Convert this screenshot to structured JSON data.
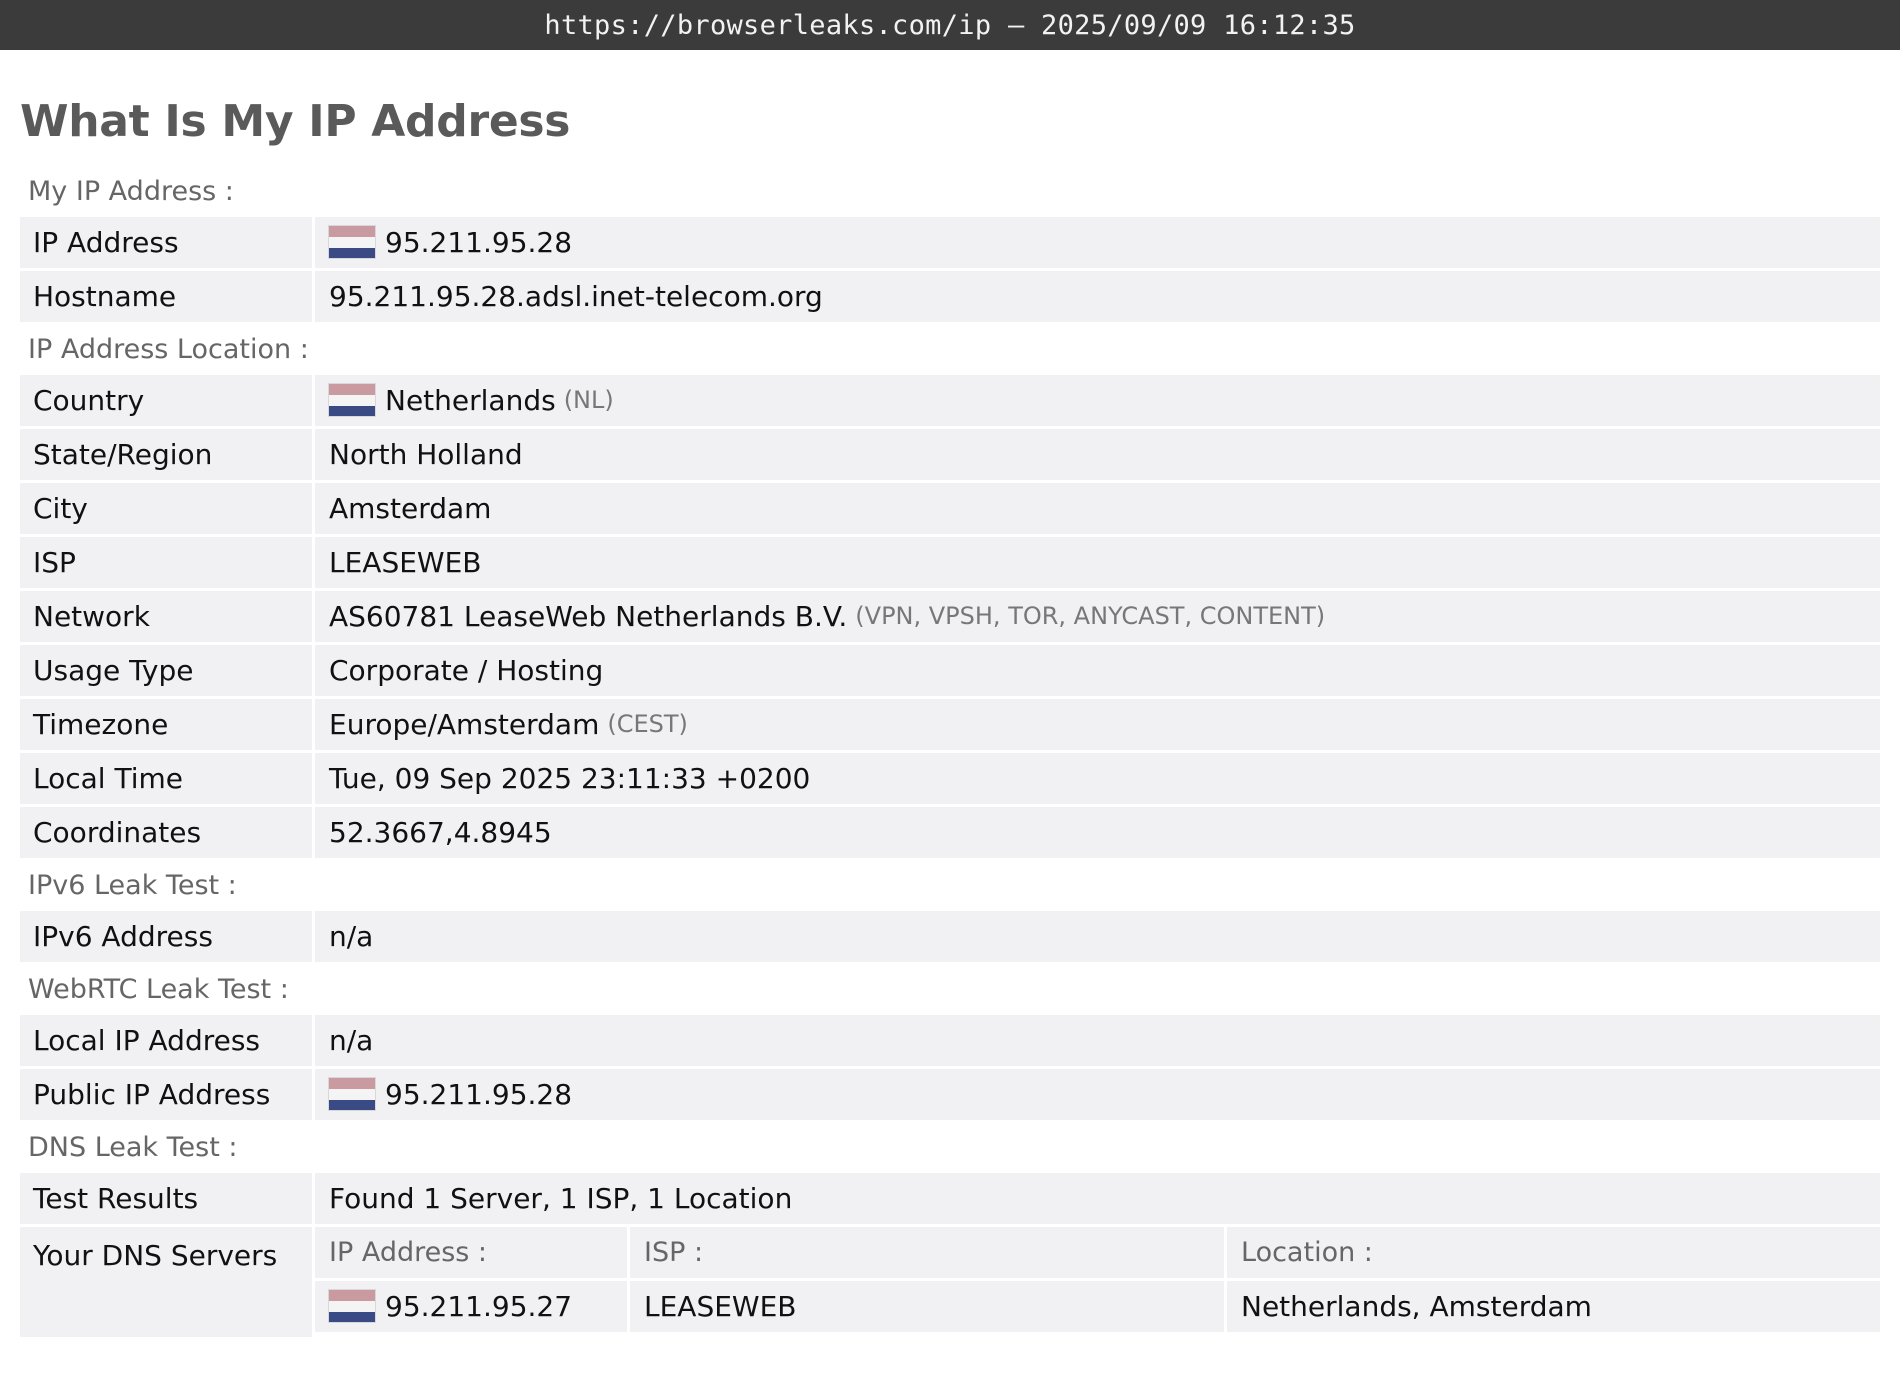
{
  "topbar": {
    "url_time": "https://browserleaks.com/ip – 2025/09/09 16:12:35"
  },
  "page_title": "What Is My IP Address",
  "sections": {
    "my_ip": {
      "title": "My IP Address :",
      "ip_label": "IP Address",
      "ip_value": "95.211.95.28",
      "hostname_label": "Hostname",
      "hostname_value": "95.211.95.28.adsl.inet-telecom.org"
    },
    "location": {
      "title": "IP Address Location :",
      "country_label": "Country",
      "country_value": "Netherlands",
      "country_code": "(NL)",
      "state_label": "State/Region",
      "state_value": "North Holland",
      "city_label": "City",
      "city_value": "Amsterdam",
      "isp_label": "ISP",
      "isp_value": "LEASEWEB",
      "network_label": "Network",
      "network_value": "AS60781 LeaseWeb Netherlands B.V.",
      "network_tags": "(VPN, VPSH, TOR, ANYCAST, CONTENT)",
      "usage_label": "Usage Type",
      "usage_value": "Corporate / Hosting",
      "timezone_label": "Timezone",
      "timezone_value": "Europe/Amsterdam",
      "timezone_abbr": "(CEST)",
      "localtime_label": "Local Time",
      "localtime_value": "Tue, 09 Sep 2025 23:11:33 +0200",
      "coords_label": "Coordinates",
      "coords_value": "52.3667,4.8945"
    },
    "ipv6": {
      "title": "IPv6 Leak Test :",
      "addr_label": "IPv6 Address",
      "addr_value": "n/a"
    },
    "webrtc": {
      "title": "WebRTC Leak Test :",
      "local_label": "Local IP Address",
      "local_value": "n/a",
      "public_label": "Public IP Address",
      "public_value": "95.211.95.28"
    },
    "dns": {
      "title": "DNS Leak Test :",
      "results_label": "Test Results",
      "results_value": "Found 1 Server, 1 ISP, 1 Location",
      "servers_label": "Your DNS Servers",
      "col_ip": "IP Address :",
      "col_isp": "ISP :",
      "col_location": "Location :",
      "server_ip": "95.211.95.27",
      "server_isp": "LEASEWEB",
      "server_location": "Netherlands, Amsterdam"
    }
  },
  "flag_icon": "netherlands-flag-icon"
}
